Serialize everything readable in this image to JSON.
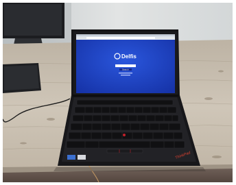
{
  "screen": {
    "site_name": "Delfis",
    "search_button": "Search",
    "background_color": "#1b3fc4",
    "browser_bar_color": "#dfe4ea"
  },
  "laptop": {
    "brand_logo": "ThinkPad",
    "trackpoint_color": "#c0202a",
    "body_color": "#17171a"
  },
  "scene": {
    "desk_color": "#c9c0b2",
    "wall_color": "#d8dbdc"
  }
}
